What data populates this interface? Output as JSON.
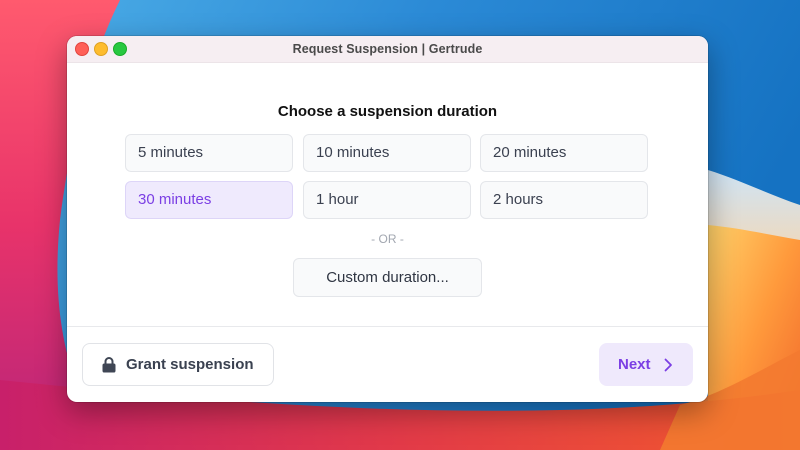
{
  "window": {
    "title": "Request Suspension  |  Gertrude"
  },
  "dialog": {
    "heading": "Choose a suspension duration",
    "options": [
      {
        "label": "5 minutes",
        "selected": false
      },
      {
        "label": "10 minutes",
        "selected": false
      },
      {
        "label": "20 minutes",
        "selected": false
      },
      {
        "label": "30 minutes",
        "selected": true
      },
      {
        "label": "1 hour",
        "selected": false
      },
      {
        "label": "2 hours",
        "selected": false
      }
    ],
    "separator": "- OR -",
    "custom_label": "Custom duration..."
  },
  "footer": {
    "grant_label": "Grant suspension",
    "grant_icon": "lock-icon",
    "next_label": "Next",
    "next_icon": "chevron-right-icon"
  },
  "colors": {
    "accent": "#7b3fe4",
    "selected_bg": "#efeafd",
    "close": "#ff5f57",
    "minimize": "#febc2e",
    "maximize": "#28c840"
  }
}
